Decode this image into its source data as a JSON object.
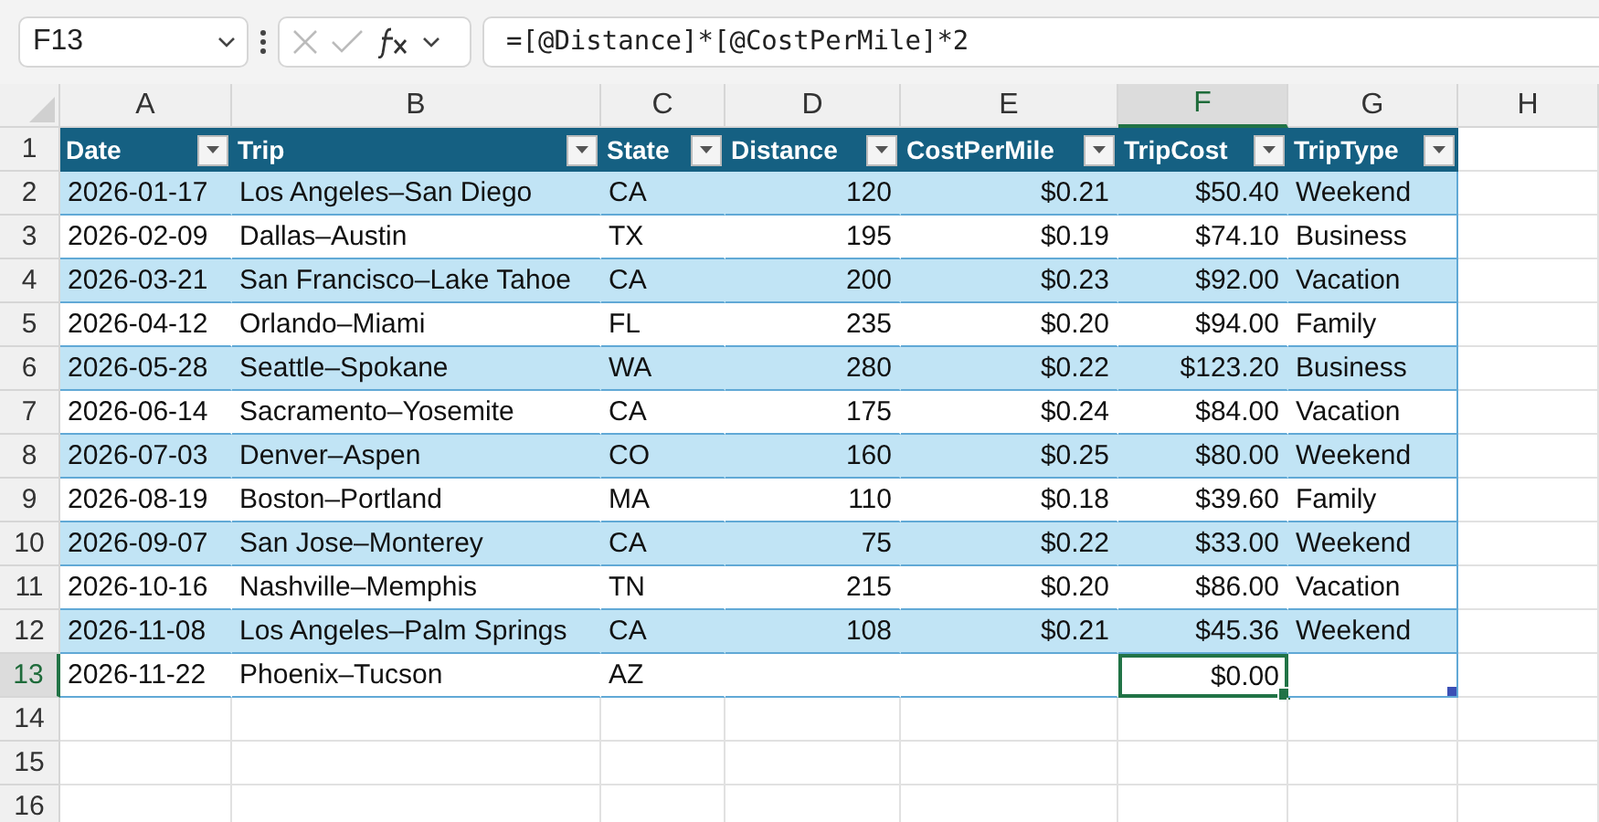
{
  "name_box": "F13",
  "formula": "=[@Distance]*[@CostPerMile]*2",
  "columns": [
    {
      "letter": "A",
      "selected": false
    },
    {
      "letter": "B",
      "selected": false
    },
    {
      "letter": "C",
      "selected": false
    },
    {
      "letter": "D",
      "selected": false
    },
    {
      "letter": "E",
      "selected": false
    },
    {
      "letter": "F",
      "selected": true
    },
    {
      "letter": "G",
      "selected": false
    },
    {
      "letter": "H",
      "selected": false
    }
  ],
  "header_row": {
    "number": "1",
    "headers": [
      "Date",
      "Trip",
      "State",
      "Distance",
      "CostPerMile",
      "TripCost",
      "TripType"
    ]
  },
  "rows": [
    {
      "number": "2",
      "selected": false,
      "cells": [
        "2026-01-17",
        "Los Angeles–San Diego",
        "CA",
        "120",
        "$0.21",
        "$50.40",
        "Weekend"
      ]
    },
    {
      "number": "3",
      "selected": false,
      "cells": [
        "2026-02-09",
        "Dallas–Austin",
        "TX",
        "195",
        "$0.19",
        "$74.10",
        "Business"
      ]
    },
    {
      "number": "4",
      "selected": false,
      "cells": [
        "2026-03-21",
        "San Francisco–Lake Tahoe",
        "CA",
        "200",
        "$0.23",
        "$92.00",
        "Vacation"
      ]
    },
    {
      "number": "5",
      "selected": false,
      "cells": [
        "2026-04-12",
        "Orlando–Miami",
        "FL",
        "235",
        "$0.20",
        "$94.00",
        "Family"
      ]
    },
    {
      "number": "6",
      "selected": false,
      "cells": [
        "2026-05-28",
        "Seattle–Spokane",
        "WA",
        "280",
        "$0.22",
        "$123.20",
        "Business"
      ]
    },
    {
      "number": "7",
      "selected": false,
      "cells": [
        "2026-06-14",
        "Sacramento–Yosemite",
        "CA",
        "175",
        "$0.24",
        "$84.00",
        "Vacation"
      ]
    },
    {
      "number": "8",
      "selected": false,
      "cells": [
        "2026-07-03",
        "Denver–Aspen",
        "CO",
        "160",
        "$0.25",
        "$80.00",
        "Weekend"
      ]
    },
    {
      "number": "9",
      "selected": false,
      "cells": [
        "2026-08-19",
        "Boston–Portland",
        "MA",
        "110",
        "$0.18",
        "$39.60",
        "Family"
      ]
    },
    {
      "number": "10",
      "selected": false,
      "cells": [
        "2026-09-07",
        "San Jose–Monterey",
        "CA",
        "75",
        "$0.22",
        "$33.00",
        "Weekend"
      ]
    },
    {
      "number": "11",
      "selected": false,
      "cells": [
        "2026-10-16",
        "Nashville–Memphis",
        "TN",
        "215",
        "$0.20",
        "$86.00",
        "Vacation"
      ]
    },
    {
      "number": "12",
      "selected": false,
      "cells": [
        "2026-11-08",
        "Los Angeles–Palm Springs",
        "CA",
        "108",
        "$0.21",
        "$45.36",
        "Weekend"
      ]
    },
    {
      "number": "13",
      "selected": true,
      "cells": [
        "2026-11-22",
        "Phoenix–Tucson",
        "AZ",
        "",
        "",
        "$0.00",
        ""
      ]
    }
  ],
  "empty_rows": [
    {
      "number": "14"
    },
    {
      "number": "15"
    },
    {
      "number": "16"
    }
  ]
}
